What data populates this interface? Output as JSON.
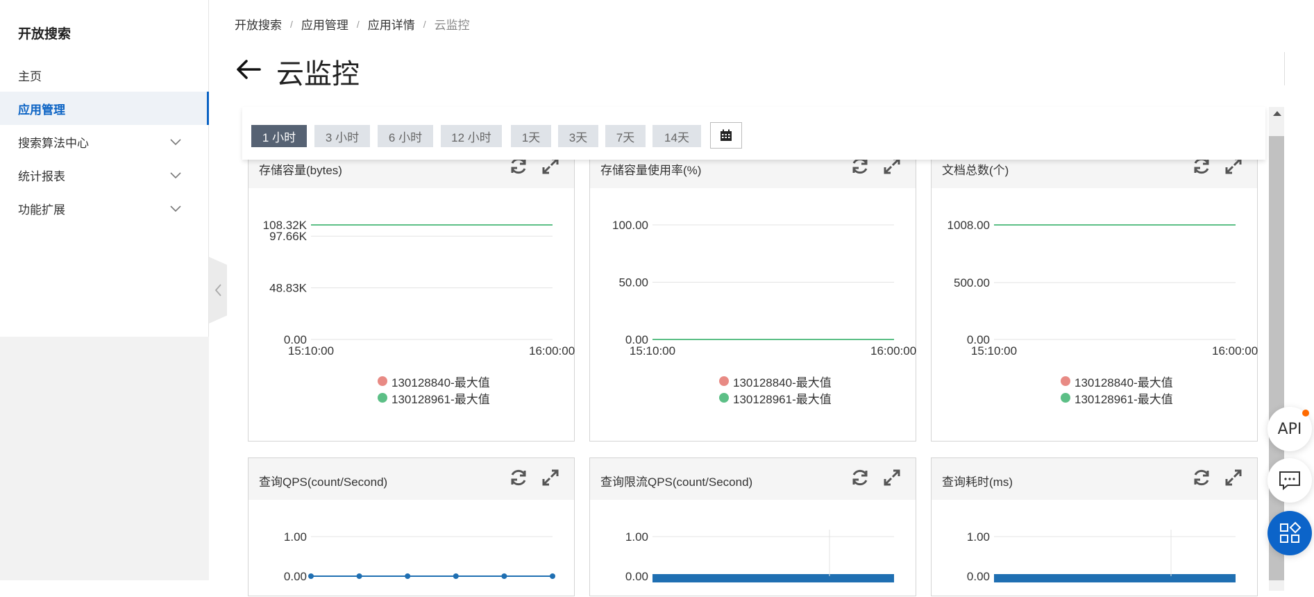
{
  "sidebar": {
    "title": "开放搜索",
    "items": [
      {
        "label": "主页"
      },
      {
        "label": "应用管理"
      },
      {
        "label": "搜索算法中心"
      },
      {
        "label": "统计报表"
      },
      {
        "label": "功能扩展"
      }
    ]
  },
  "breadcrumb": [
    "开放搜索",
    "应用管理",
    "应用详情",
    "云监控"
  ],
  "page_title": "云监控",
  "time_ranges": [
    "1 小时",
    "3 小时",
    "6 小时",
    "12 小时",
    "1天",
    "3天",
    "7天",
    "14天"
  ],
  "active_range": "1 小时",
  "panels": [
    {
      "title": "存储容量(bytes)"
    },
    {
      "title": "存储容量使用率(%)"
    },
    {
      "title": "文档总数(个)"
    },
    {
      "title": "查询QPS(count/Second)"
    },
    {
      "title": "查询限流QPS(count/Second)"
    },
    {
      "title": "查询耗时(ms)"
    }
  ],
  "legend": [
    "130128840-最大值",
    "130128961-最大值"
  ],
  "colors": {
    "series1": "#e88a84",
    "series2": "#5cbf86",
    "accent": "#0b63c4",
    "line_blue": "#1f6fb2"
  },
  "float_buttons": {
    "api_label": "API"
  },
  "chart_data": [
    {
      "type": "line",
      "title": "存储容量(bytes)",
      "x": [
        "15:10:00",
        "16:00:00"
      ],
      "yticks": [
        "0.00",
        "48.83K",
        "97.66K",
        "108.32K"
      ],
      "series": [
        {
          "name": "130128840-最大值",
          "values": [
            108320,
            108320
          ]
        },
        {
          "name": "130128961-最大值",
          "values": [
            108320,
            108320
          ]
        }
      ]
    },
    {
      "type": "line",
      "title": "存储容量使用率(%)",
      "x": [
        "15:10:00",
        "16:00:00"
      ],
      "yticks": [
        "0.00",
        "50.00",
        "100.00"
      ],
      "series": [
        {
          "name": "130128840-最大值",
          "values": [
            0,
            0
          ]
        },
        {
          "name": "130128961-最大值",
          "values": [
            0,
            0
          ]
        }
      ]
    },
    {
      "type": "line",
      "title": "文档总数(个)",
      "x": [
        "15:10:00",
        "16:00:00"
      ],
      "yticks": [
        "0.00",
        "500.00",
        "1008.00"
      ],
      "series": [
        {
          "name": "130128840-最大值",
          "values": [
            1008,
            1008
          ]
        },
        {
          "name": "130128961-最大值",
          "values": [
            1008,
            1008
          ]
        }
      ]
    },
    {
      "type": "line",
      "title": "查询QPS(count/Second)",
      "yticks": [
        "0.00",
        "1.00"
      ],
      "series": [
        {
          "values": [
            0,
            0,
            0,
            0,
            0,
            0
          ]
        }
      ]
    },
    {
      "type": "bar",
      "title": "查询限流QPS(count/Second)",
      "yticks": [
        "0.00",
        "1.00"
      ]
    },
    {
      "type": "bar",
      "title": "查询耗时(ms)",
      "yticks": [
        "0.00",
        "1.00"
      ]
    }
  ]
}
